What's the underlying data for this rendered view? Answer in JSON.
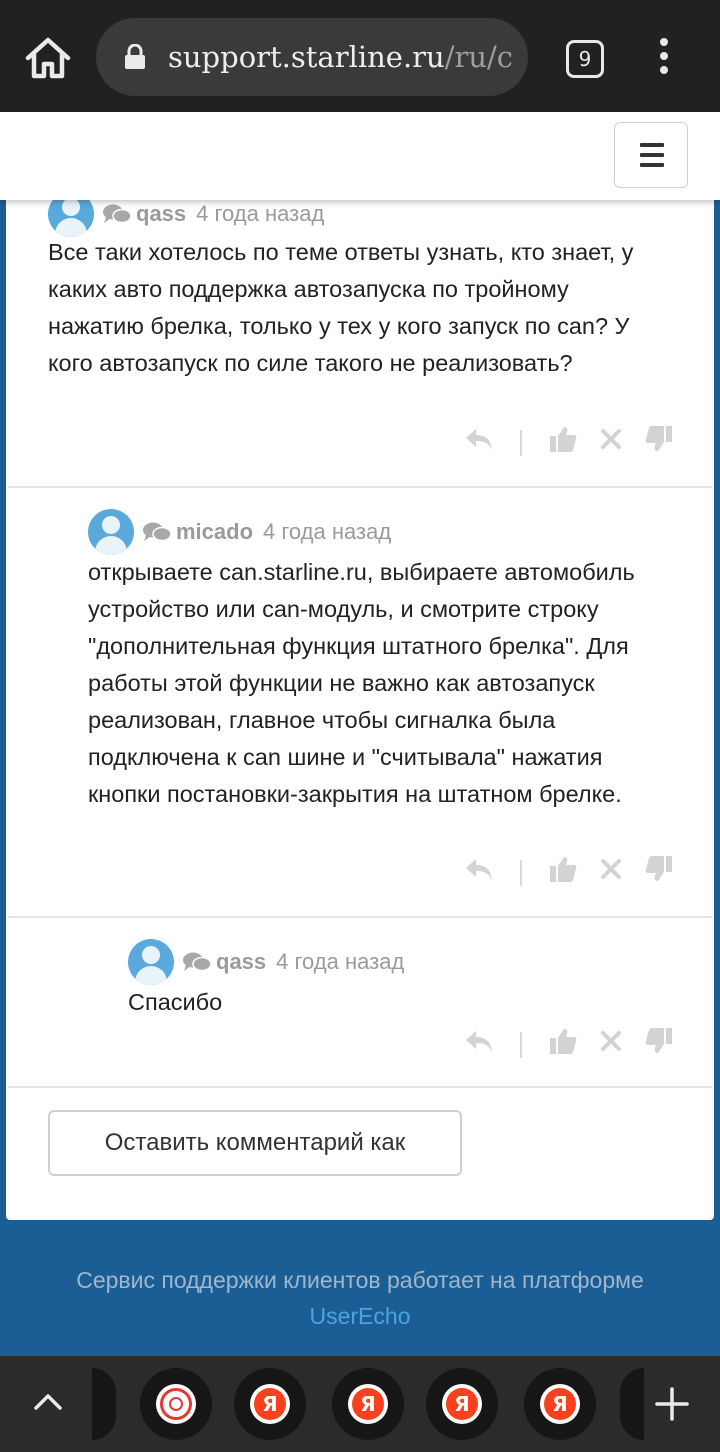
{
  "browser": {
    "url_domain": "support.starline.ru",
    "url_path": "/ru/con",
    "tab_count": "9"
  },
  "comments": [
    {
      "author": "qass",
      "time": "4 года назад",
      "text": "Все таки хотелось по теме ответы узнать, кто знает, у каких авто поддержка автозапуска по тройному нажатию брелка, только у тех у кого запуск по can? У кого автозапуск по силе такого не реализовать?"
    },
    {
      "author": "micado",
      "time": "4 года назад",
      "text": "открываете can.starline.ru, выбираете автомобиль устройство или can-модуль, и смотрите строку \"дополнительная функция штатного брелка\". Для работы этой функции не важно как автозапуск реализован, главное чтобы сигналка была подключена к can шине и \"считывала\" нажатия кнопки постановки-закрытия на штатном брелке."
    },
    {
      "author": "qass",
      "time": "4 года назад",
      "text": "Спасибо"
    }
  ],
  "icons": [
    "home-icon",
    "lock-icon",
    "menu-icon",
    "chat-bubbles-icon",
    "reply-icon",
    "thumbs-up-icon",
    "close-icon",
    "thumbs-down-icon",
    "chevron-up-icon",
    "plus-icon"
  ],
  "leave_comment_label": "Оставить комментарий как",
  "footer": {
    "text": "Сервис поддержки клиентов работает на платформе",
    "link": "UserEcho"
  },
  "bottom_tabs": {
    "yandex_letter": "Я"
  },
  "colors": {
    "link": "#4da3e0",
    "avatar": "#5aa9dc",
    "footer_bg": "#1b5e95",
    "yandex": "#fc3f1d"
  }
}
